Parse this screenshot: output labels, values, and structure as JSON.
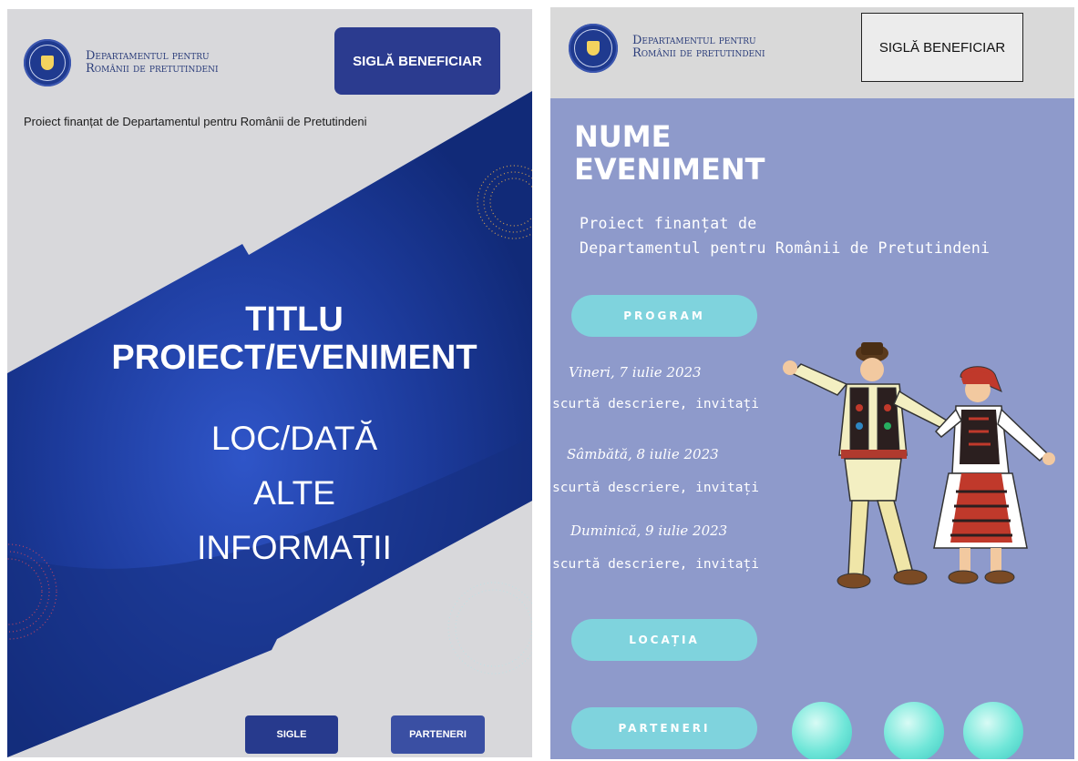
{
  "left": {
    "gov_name_line1": "Departamentul pentru",
    "gov_name_line2": "Românii de pretutindeni",
    "beneficiary_logo": "SIGLĂ BENEFICIAR",
    "funded_by": "Proiect finanțat de Departamentul pentru Românii de Pretutindeni",
    "title_line1": "TITLU",
    "title_line2": "PROIECT/EVENIMENT",
    "info_line1": "LOC/DATĂ",
    "info_line2": "ALTE",
    "info_line3": "INFORMAȚII",
    "sigle_button": "SIGLE",
    "parteneri_button": "PARTENERI"
  },
  "right": {
    "gov_name_line1": "Departamentul pentru",
    "gov_name_line2": "Românii de pretutindeni",
    "beneficiary_logo": "SIGLĂ BENEFICIAR",
    "event_name_line1": "NUME",
    "event_name_line2": "EVENIMENT",
    "funded_line1": "Proiect finanțat de",
    "funded_line2": "Departamentul pentru Românii de Pretutindeni",
    "program_button": "PROGRAM",
    "schedule": [
      {
        "day": "Vineri, 7 iulie 2023",
        "description": "scurtă descriere, invitați"
      },
      {
        "day": "Sâmbătă, 8 iulie 2023",
        "description": "scurtă descriere, invitați"
      },
      {
        "day": "Duminică, 9 iulie 2023",
        "description": "scurtă descriere, invitați"
      }
    ],
    "locatia_button": "LOCAȚIA",
    "parteneri_button": "PARTENERI"
  },
  "colors": {
    "left_background": "#d8d8db",
    "left_band": "#1f3da0",
    "right_background": "#8e9acb",
    "pill": "#7fd3dd",
    "gov_blue": "#1f3a8f"
  }
}
